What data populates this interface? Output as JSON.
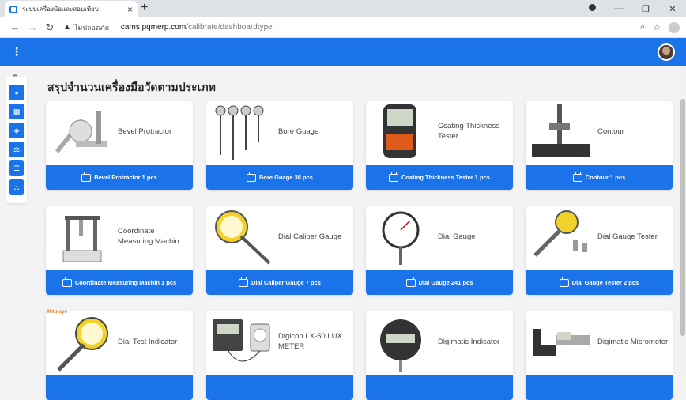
{
  "browser": {
    "tab_title": "ระบบเครื่องมือและสอบเทียบ",
    "tab_close": "×",
    "new_tab": "+",
    "warning_icon": "▲",
    "insecure_label": "ไม่ปลอดภัย",
    "url_host": "cams.pqmerp.com",
    "url_path": "/calibrate/dashboardtype",
    "zoom_icon": "⌕",
    "star_icon": "☆",
    "win_min": "—",
    "win_restore": "❐",
    "win_close": "✕"
  },
  "appbar": {
    "menu_icon": "⋮"
  },
  "page": {
    "heading": "สรุปจำนวนเครื่องมือวัดตามประเภท"
  },
  "colors": {
    "primary": "#1a73e8"
  },
  "cards": [
    {
      "title": "Bevel Protractor",
      "button": "Bevel Protractor 1 pcs"
    },
    {
      "title": "Bore Guage",
      "button": "Bore Guage 38 pcs"
    },
    {
      "title": "Coating Thickness Tester",
      "button": "Coating Thickness Tester 1 pcs"
    },
    {
      "title": "Contour",
      "button": "Contour 1 pcs"
    },
    {
      "title": "Coordinate Measuring Machin",
      "button": "Coordinate Measuring Machin 1 pcs"
    },
    {
      "title": "Dial Caliper Gauge",
      "button": "Dial Caliper Gauge 7 pcs"
    },
    {
      "title": "Dial Gauge",
      "button": "Dial Gauge 241 pcs"
    },
    {
      "title": "Dial Gauge Tester",
      "button": "Dial Gauge Tester 2 pcs"
    },
    {
      "title": "Dial Test Indicator",
      "button": ""
    },
    {
      "title": "Digicon LX-50 LUX METER",
      "button": ""
    },
    {
      "title": "Digimatic Indicator",
      "button": ""
    },
    {
      "title": "Digimatic Micrometer",
      "button": ""
    }
  ],
  "brand_tag": "Mitutoyo"
}
